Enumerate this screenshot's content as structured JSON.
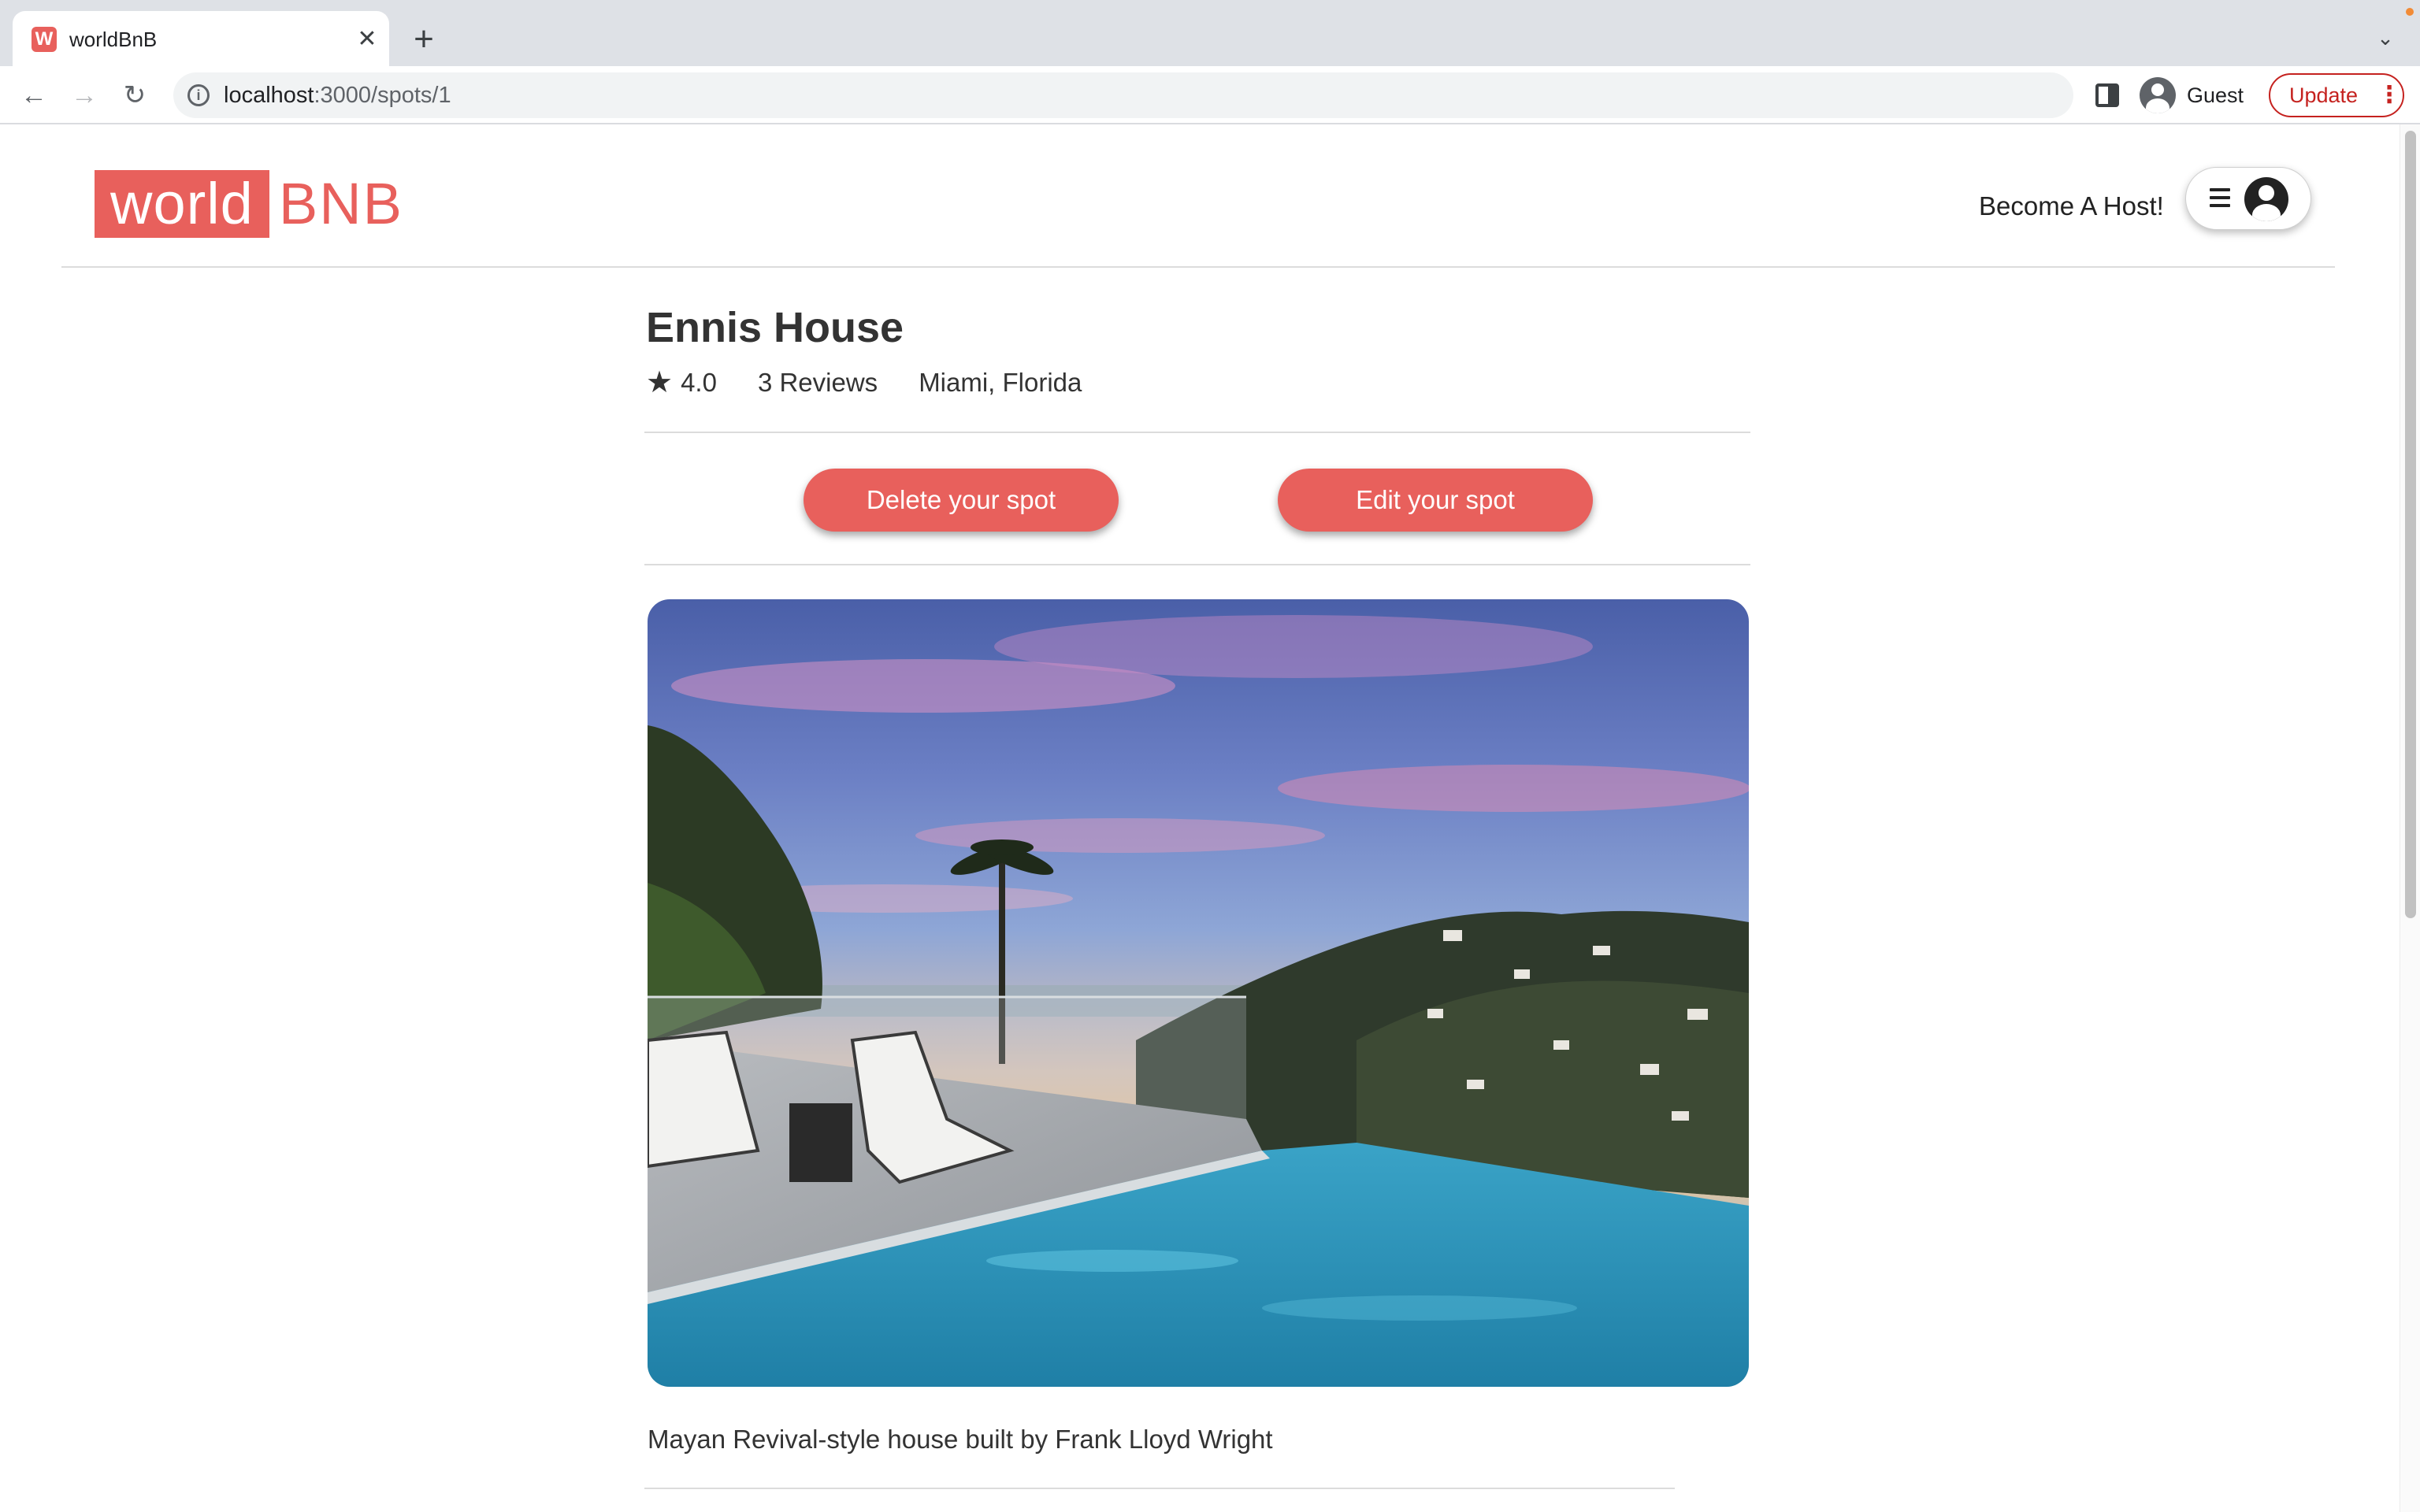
{
  "browser": {
    "tab_title": "worldBnB",
    "tab_favicon": "W",
    "url_host": "localhost",
    "url_path": ":3000/spots/1",
    "profile_label": "Guest",
    "update_label": "Update"
  },
  "icons": {
    "tab_close": "close-icon",
    "new_tab": "plus-icon",
    "back": "arrow-left-icon",
    "forward": "arrow-right-icon",
    "reload": "reload-icon",
    "site_info": "info-icon",
    "side_panel": "side-panel-icon",
    "menu": "hamburger-icon",
    "user": "user-circle-icon",
    "rating": "star-icon"
  },
  "colors": {
    "brand": "#e8605c",
    "text": "#333333",
    "rule": "#dcdcdc"
  },
  "site": {
    "logo_box_text": "world",
    "logo_text": "BNB",
    "host_link": "Become A Host!"
  },
  "spot": {
    "title": "Ennis House",
    "rating": "4.0",
    "reviews": "3 Reviews",
    "location": "Miami, Florida",
    "delete_label": "Delete your spot",
    "edit_label": "Edit your spot",
    "description": "Mayan Revival-style house built by Frank Lloyd Wright"
  }
}
